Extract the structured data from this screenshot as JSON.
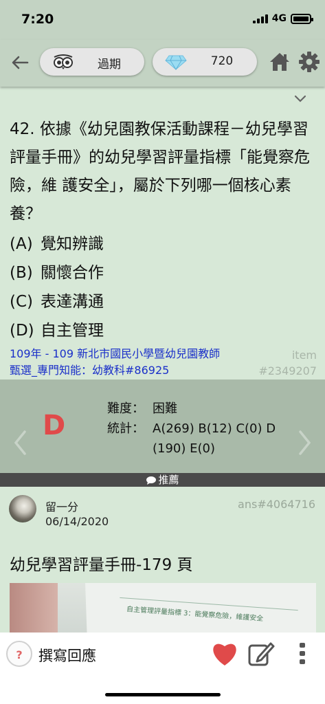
{
  "status": {
    "time": "7:20",
    "network": "4G"
  },
  "toolbar": {
    "status_label": "過期",
    "gem_count": "720"
  },
  "question": {
    "text": "42. 依據《幼兒園教保活動課程－幼兒學習評量手冊》的幼兒學習評量指標「能覺察危險，維 護安全」，屬於下列哪一個核心素養？",
    "options": [
      {
        "letter": "(A)",
        "text": "覺知辨識"
      },
      {
        "letter": "(B)",
        "text": "關懷合作"
      },
      {
        "letter": "(C)",
        "text": "表達溝通"
      },
      {
        "letter": "(D)",
        "text": "自主管理"
      }
    ],
    "source_line1": "109年 - 109 新北市國民小學暨幼兒園教師",
    "source_line2": "甄選_專門知能：幼教科#86925",
    "item_label": "item",
    "item_id": "#2349207"
  },
  "answer": {
    "letter": "D",
    "difficulty_label": "難度：",
    "difficulty_value": "困難",
    "stats_label": "統計：",
    "stats_value": "A(269) B(12) C(0) D (190) E(0)"
  },
  "recommend_label": "推薦",
  "comment": {
    "user": "留一分",
    "date": "06/14/2020",
    "ans_id": "ans#4064716",
    "body": "幼兒學習評量手冊-179 頁",
    "photo_caption": "自主管理評量指標 3：能覺察危險，維護安全"
  },
  "bottom": {
    "reply_label": "撰寫回應",
    "question_mark": "?"
  },
  "colors": {
    "accent_red": "#e04a4a",
    "link_blue": "#1a2fc9",
    "bg_green": "#d7e8d7",
    "toolbar_green": "#c3d3c3"
  }
}
